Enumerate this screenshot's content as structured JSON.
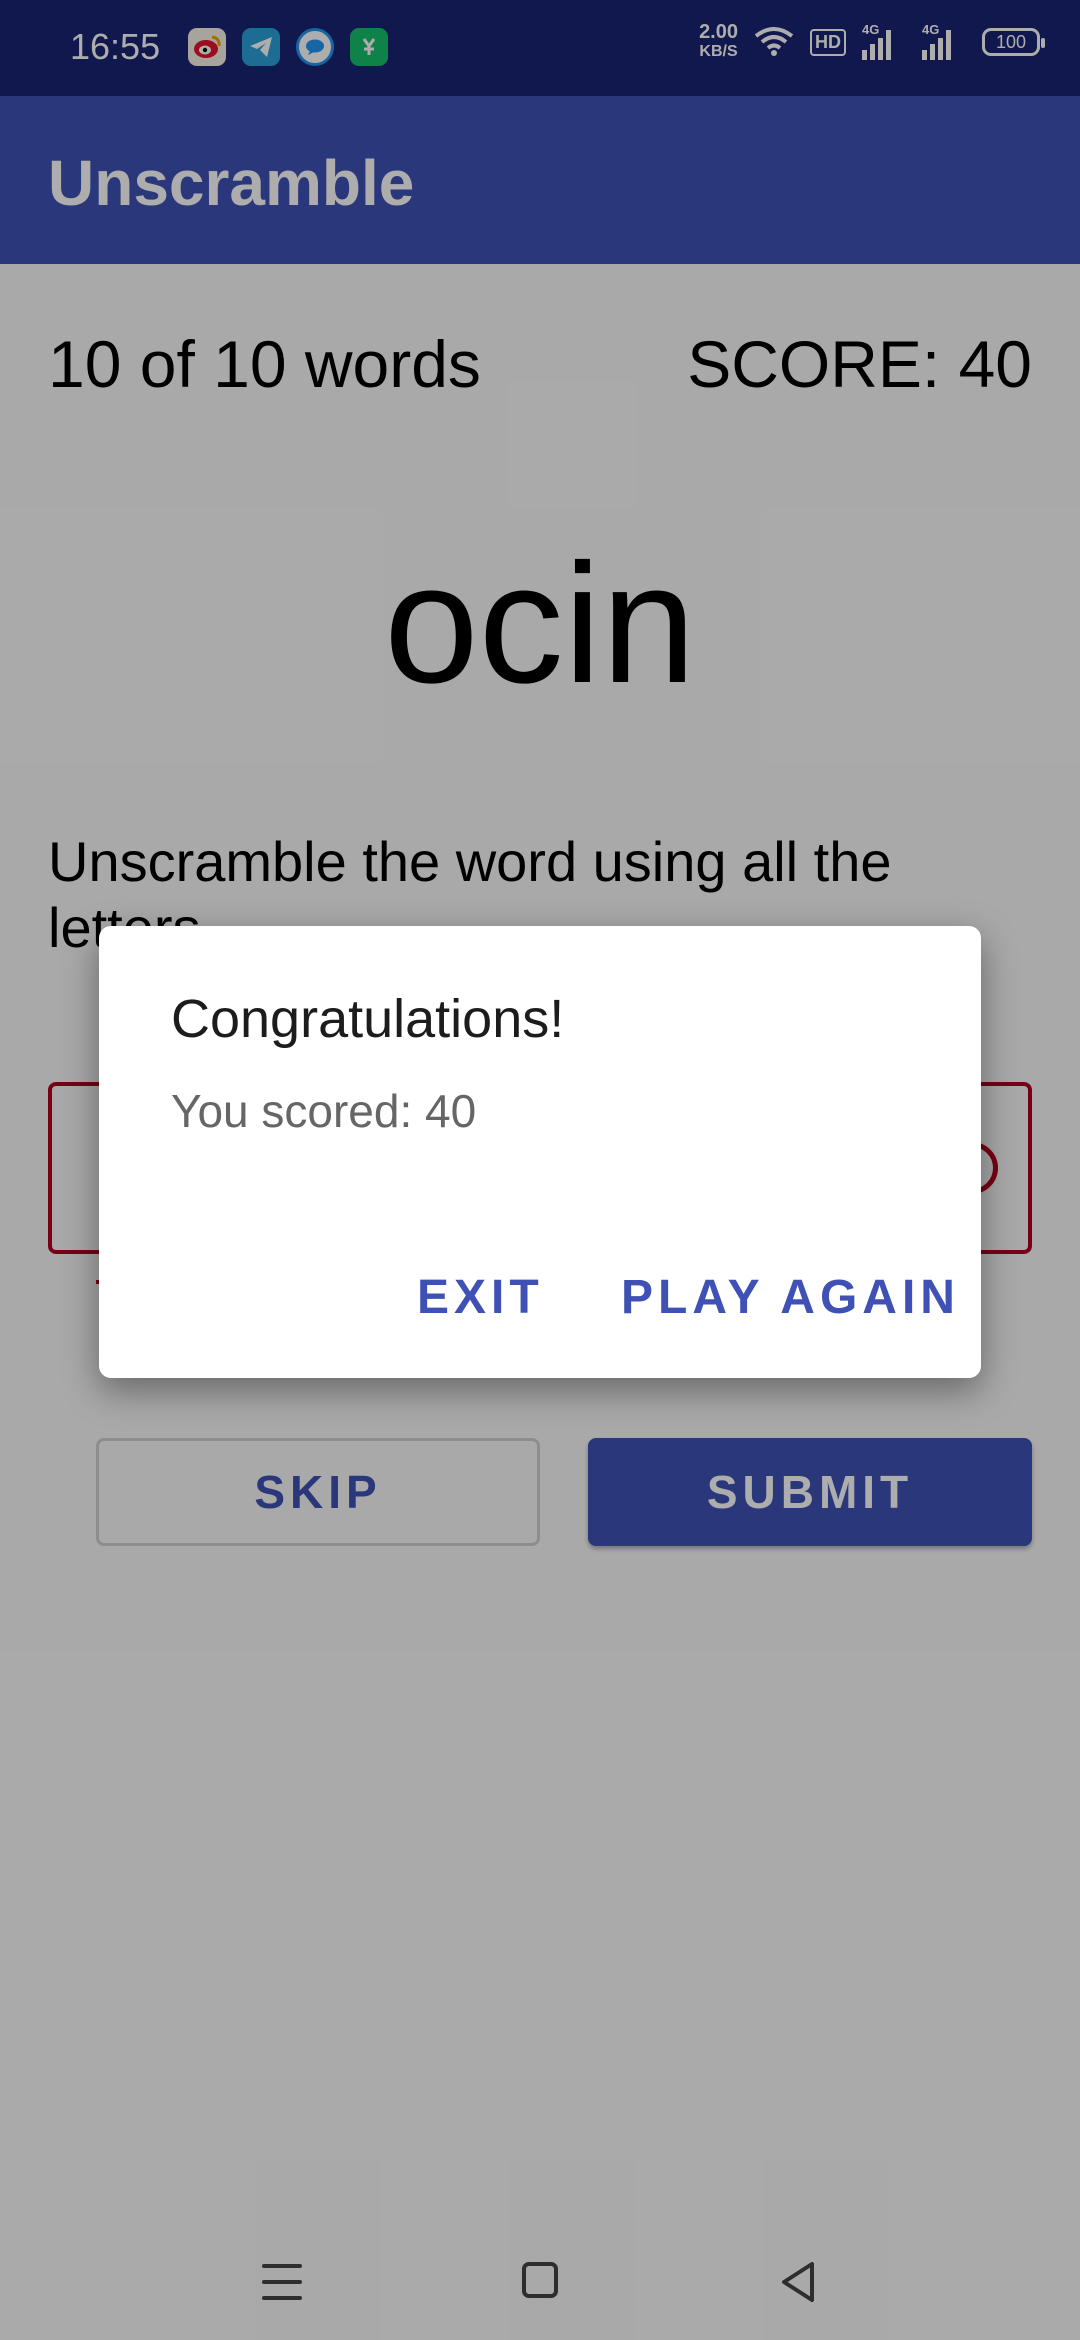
{
  "status_bar": {
    "time": "16:55",
    "net_speed_value": "2.00",
    "net_speed_unit": "KB/S",
    "hd_label": "HD",
    "signal_label_1": "4G",
    "signal_label_2": "4G",
    "battery": "100",
    "notification_icons": [
      "weibo-icon",
      "telegram-icon",
      "chat-bubble-icon",
      "app-store-icon"
    ]
  },
  "app_bar": {
    "title": "Unscramble"
  },
  "game": {
    "word_count": "10 of 10 words",
    "score": "SCORE: 40",
    "scrambled_word": "ocin",
    "instructions": "Unscramble the word using all the letters."
  },
  "buttons": {
    "skip": "SKIP",
    "submit": "SUBMIT"
  },
  "dialog": {
    "title": "Congratulations!",
    "message": "You scored: 40",
    "exit": "EXIT",
    "play_again": "PLAY AGAIN"
  },
  "colors": {
    "primary": "#3f51b5",
    "status_bar": "#1a2472",
    "error": "#b00020"
  }
}
